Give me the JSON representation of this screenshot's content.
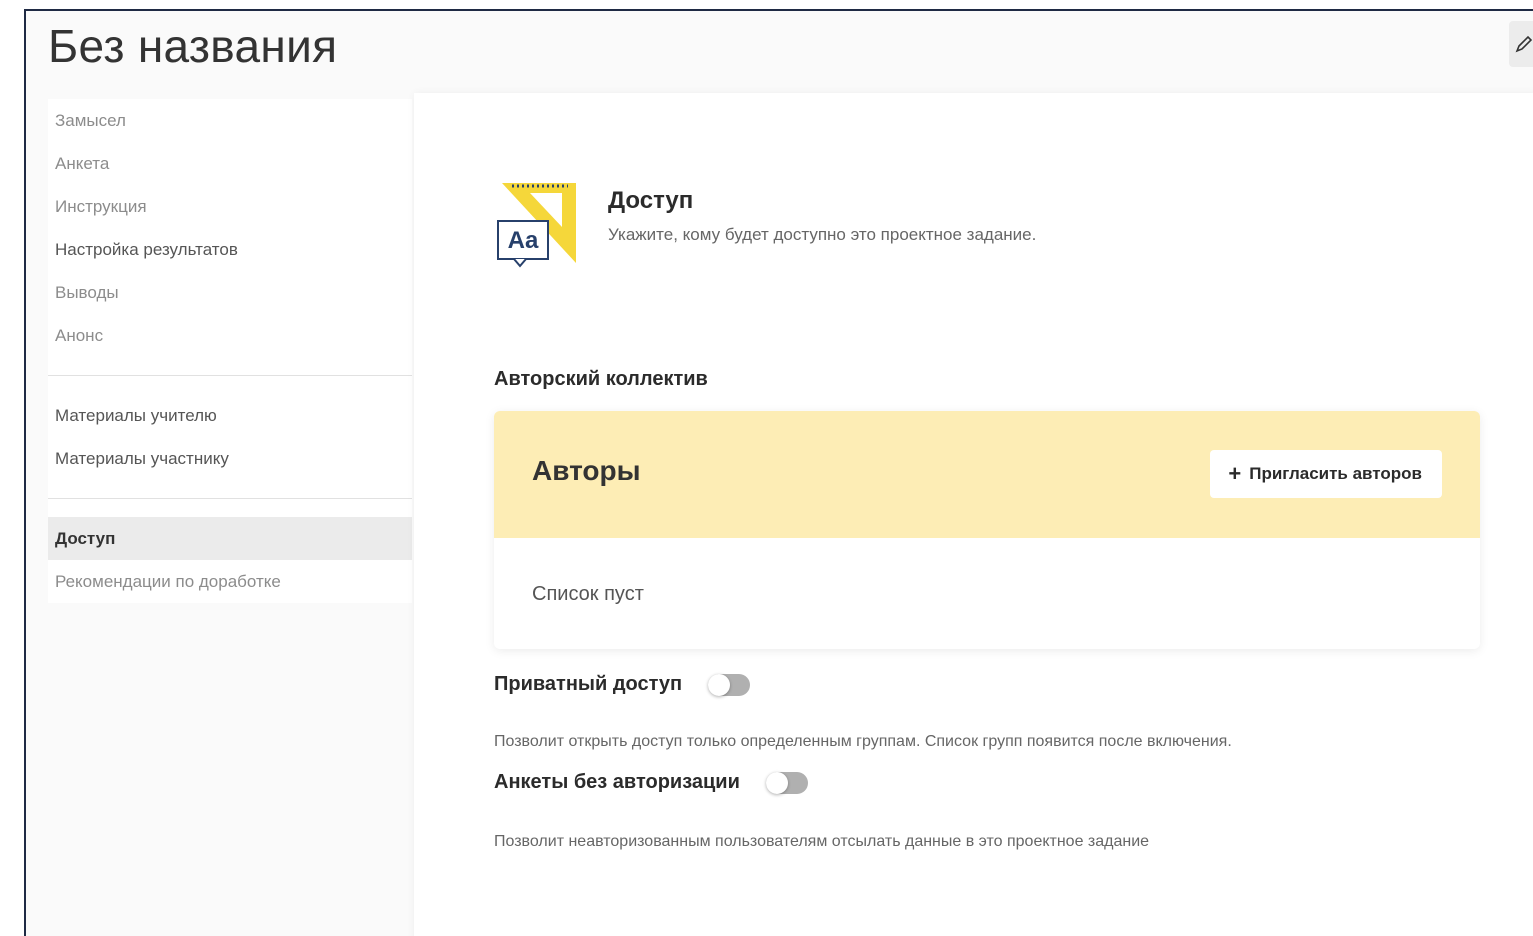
{
  "page": {
    "title": "Без названия"
  },
  "sidebar": {
    "group1": [
      "Замысел",
      "Анкета",
      "Инструкция",
      "Настройка результатов",
      "Выводы",
      "Анонс"
    ],
    "group2": [
      "Материалы учителю",
      "Материалы участнику"
    ],
    "group3": [
      "Доступ",
      "Рекомендации по доработке"
    ],
    "active_item": "Доступ"
  },
  "section": {
    "title": "Доступ",
    "description": "Укажите, кому будет доступно это проектное задание.",
    "icon": "aa-text-icon",
    "icon_text": "Aa"
  },
  "authors": {
    "group_label": "Авторский коллектив",
    "card_title": "Авторы",
    "invite_label": "Пригласить авторов",
    "empty_text": "Список пуст"
  },
  "private_access": {
    "label": "Приватный доступ",
    "enabled": false,
    "help": "Позволит открыть доступ только определенным группам. Список групп появится после включения."
  },
  "anon_forms": {
    "label": "Анкеты без авторизации",
    "enabled": false,
    "help": "Позволит неавторизованным пользователям отсылать данные в это проектное задание"
  },
  "colors": {
    "accent_yellow": "#fdedb5",
    "icon_yellow": "#f5d73a",
    "icon_blue": "#27406b",
    "frame_border": "#1f2a44"
  }
}
